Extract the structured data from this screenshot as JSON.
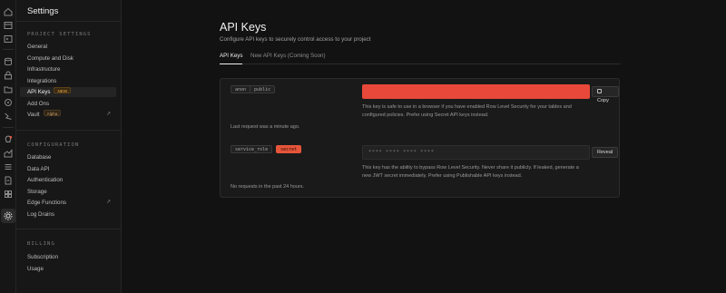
{
  "rail": {
    "icons": [
      "home-icon",
      "table-editor-icon",
      "sql-editor-icon",
      "database-icon",
      "authentication-icon",
      "storage-icon",
      "edge-functions-icon",
      "realtime-icon",
      "advisors-icon",
      "reports-icon",
      "logs-icon",
      "api-docs-icon",
      "integrations-icon",
      "settings-icon"
    ]
  },
  "sidebar": {
    "title": "Settings",
    "sections": [
      {
        "heading": "PROJECT SETTINGS",
        "items": [
          {
            "label": "General"
          },
          {
            "label": "Compute and Disk"
          },
          {
            "label": "Infrastructure"
          },
          {
            "label": "Integrations"
          },
          {
            "label": "API Keys",
            "badge": "NEW",
            "active": true
          },
          {
            "label": "Add Ons"
          },
          {
            "label": "Vault",
            "badge": "Alpha",
            "external": true
          }
        ]
      },
      {
        "heading": "CONFIGURATION",
        "items": [
          {
            "label": "Database"
          },
          {
            "label": "Data API"
          },
          {
            "label": "Authentication"
          },
          {
            "label": "Storage"
          },
          {
            "label": "Edge Functions",
            "external": true
          },
          {
            "label": "Log Drains"
          }
        ]
      },
      {
        "heading": "BILLING",
        "items": [
          {
            "label": "Subscription"
          },
          {
            "label": "Usage"
          }
        ]
      }
    ],
    "external_glyph": "↗"
  },
  "main": {
    "title": "API Keys",
    "subtitle": "Configure API keys to securely control access to your project",
    "tabs": [
      {
        "label": "API Keys",
        "active": true
      },
      {
        "label": "New API Keys (Coming Soon)",
        "active": false
      }
    ],
    "keys": [
      {
        "tags": [
          "anon",
          "public"
        ],
        "value_redacted": true,
        "button_label": "Copy",
        "note_line1": "This key is safe to use in a browser if you have enabled Row Level Security for your tables and",
        "note_line2": "configured policies. Prefer using Secret API keys instead.",
        "last_request": "Last request was a minute ago."
      },
      {
        "tags": [
          "service_role",
          "secret"
        ],
        "masked_value": "**** **** **** ****",
        "button_label": "Reveal",
        "note_line1": "This key has the ability to bypass Row Level Security. Never share it publicly. If leaked, generate a",
        "note_line2": "new JWT secret immediately. Prefer using Publishable API keys instead.",
        "last_request": "No requests in the past 24 hours."
      }
    ]
  },
  "colors": {
    "background": "#121212",
    "sidebar": "#171717",
    "card": "#1a1a1a",
    "accent_redacted": "#e8483a",
    "secret_tag": "#e5553a",
    "new_badge": "#e8a94a"
  }
}
